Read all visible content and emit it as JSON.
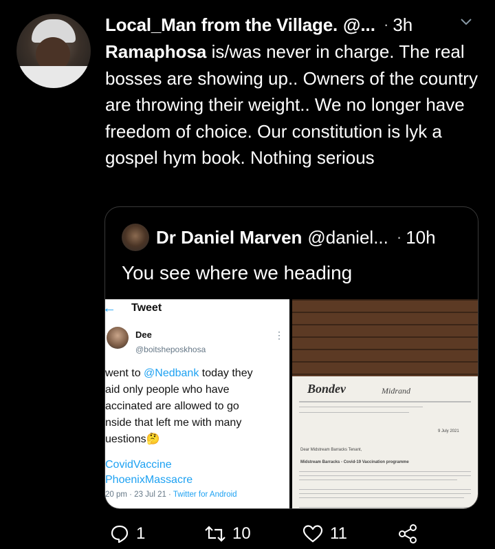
{
  "tweet": {
    "author_name": "Local_Man from the Village.",
    "handle": "@...",
    "dot": "·",
    "time": "3h",
    "text_bold": "Ramaphosa",
    "text": " is/was never in charge. The real bosses are showing up.. Owners of the country are throwing their weight.. We no longer have freedom of choice. Our constitution is lyk a gospel hym book. Nothing serious"
  },
  "quoted": {
    "author_name": "Dr Daniel Marven",
    "handle": "@daniel...",
    "dot": "·",
    "time": "10h",
    "text": "You see where we  heading"
  },
  "screenshot": {
    "back": "←",
    "title": "Tweet",
    "name": "Dee",
    "handle": "@boitsheposkhosa",
    "more": "⋮",
    "body_1": "went to ",
    "body_link": "@Nedbank",
    "body_2": " today they\naid only people who have\naccinated are allowed to go\nnside that left me with many\nuestions🤔",
    "hashtags": "CovidVaccine\nPhoenixMassacre",
    "meta_time": "20 pm · 23 Jul 21 · ",
    "meta_client": "Twitter for Android"
  },
  "letter": {
    "brand": "Bondev",
    "brand2": "Midrand",
    "date": "9 July 2021",
    "greeting": "Dear Midstream Barracks Tenant,",
    "subject": "Midstream Barracks - Covid-19 Vaccination programme"
  },
  "actions": {
    "replies": "1",
    "retweets": "10",
    "likes": "11"
  },
  "colors": {
    "background": "#000000",
    "text": "#ffffff",
    "link": "#1da1f2",
    "border": "#3a3a3a"
  }
}
